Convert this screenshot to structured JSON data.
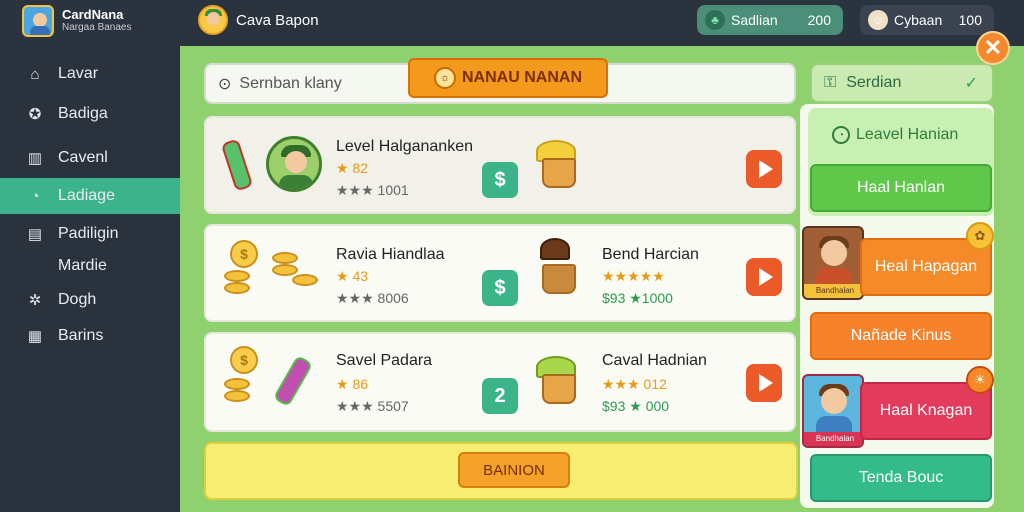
{
  "header": {
    "app_title": "CardNana",
    "app_subtitle": "Nargaa Banaes",
    "player_name": "Cava Bapon",
    "stats": [
      {
        "label": "Sadlian",
        "value": "200",
        "icon": "clover-icon"
      },
      {
        "label": "Cybaan",
        "value": "100",
        "icon": "face-icon"
      }
    ]
  },
  "sidebar": {
    "items": [
      {
        "label": "Lavar",
        "icon": "shop-icon"
      },
      {
        "label": "Badiga",
        "icon": "badge-icon"
      },
      {
        "label": "Cavenl",
        "icon": "chart-icon"
      },
      {
        "label": "Ladiage",
        "icon": "chat-icon",
        "active": true
      },
      {
        "label": "Padiligin",
        "icon": "book-icon"
      },
      {
        "label": "Mardie",
        "icon": ""
      },
      {
        "label": "Dogh",
        "icon": "gear-icon"
      },
      {
        "label": "Barins",
        "icon": "bars-icon"
      }
    ]
  },
  "main": {
    "search_placeholder": "Sernban klany",
    "ribbon_title": "NANAU NANAN",
    "items": [
      {
        "title": "Level Halgananken",
        "rating_top": "★ 82",
        "rating_bottom": "★★★ 1001",
        "buy_icon": "$"
      },
      {
        "title": "Ravia Hiandlaa",
        "rating_top": "★ 43",
        "rating_bottom": "★★★ 8006",
        "buy_icon": "$",
        "title2": "Bend Harcian",
        "rating2_top": "★★★★★",
        "rating2_bottom": "$93 ★1000"
      },
      {
        "title": "Savel Padara",
        "rating_top": "★ 86",
        "rating_bottom": "★★★ 5507",
        "buy_icon": "2",
        "title2": "Caval Hadnian",
        "rating2_top": "★★★ 012",
        "rating2_bottom": "$93 ★ 000"
      }
    ],
    "claim_label": "BAINION"
  },
  "right_panel": {
    "header_label": "Serdian",
    "level_label": "Leavel Hanian",
    "btn1": "Haal Hanlan",
    "btn2": "Heal Hapagan",
    "btn3": "Nañade Kinus",
    "btn4": "Haal Knagan",
    "btn5": "Tenda Bouc",
    "card1_caption": "Bandhalan",
    "card2_caption": "Bandhalan"
  },
  "colors": {
    "accent": "#3cb38a",
    "background_main": "#8fd16f",
    "sidebar": "#2a323d",
    "play_button": "#ed5a2a",
    "close_button": "#f5882c"
  }
}
